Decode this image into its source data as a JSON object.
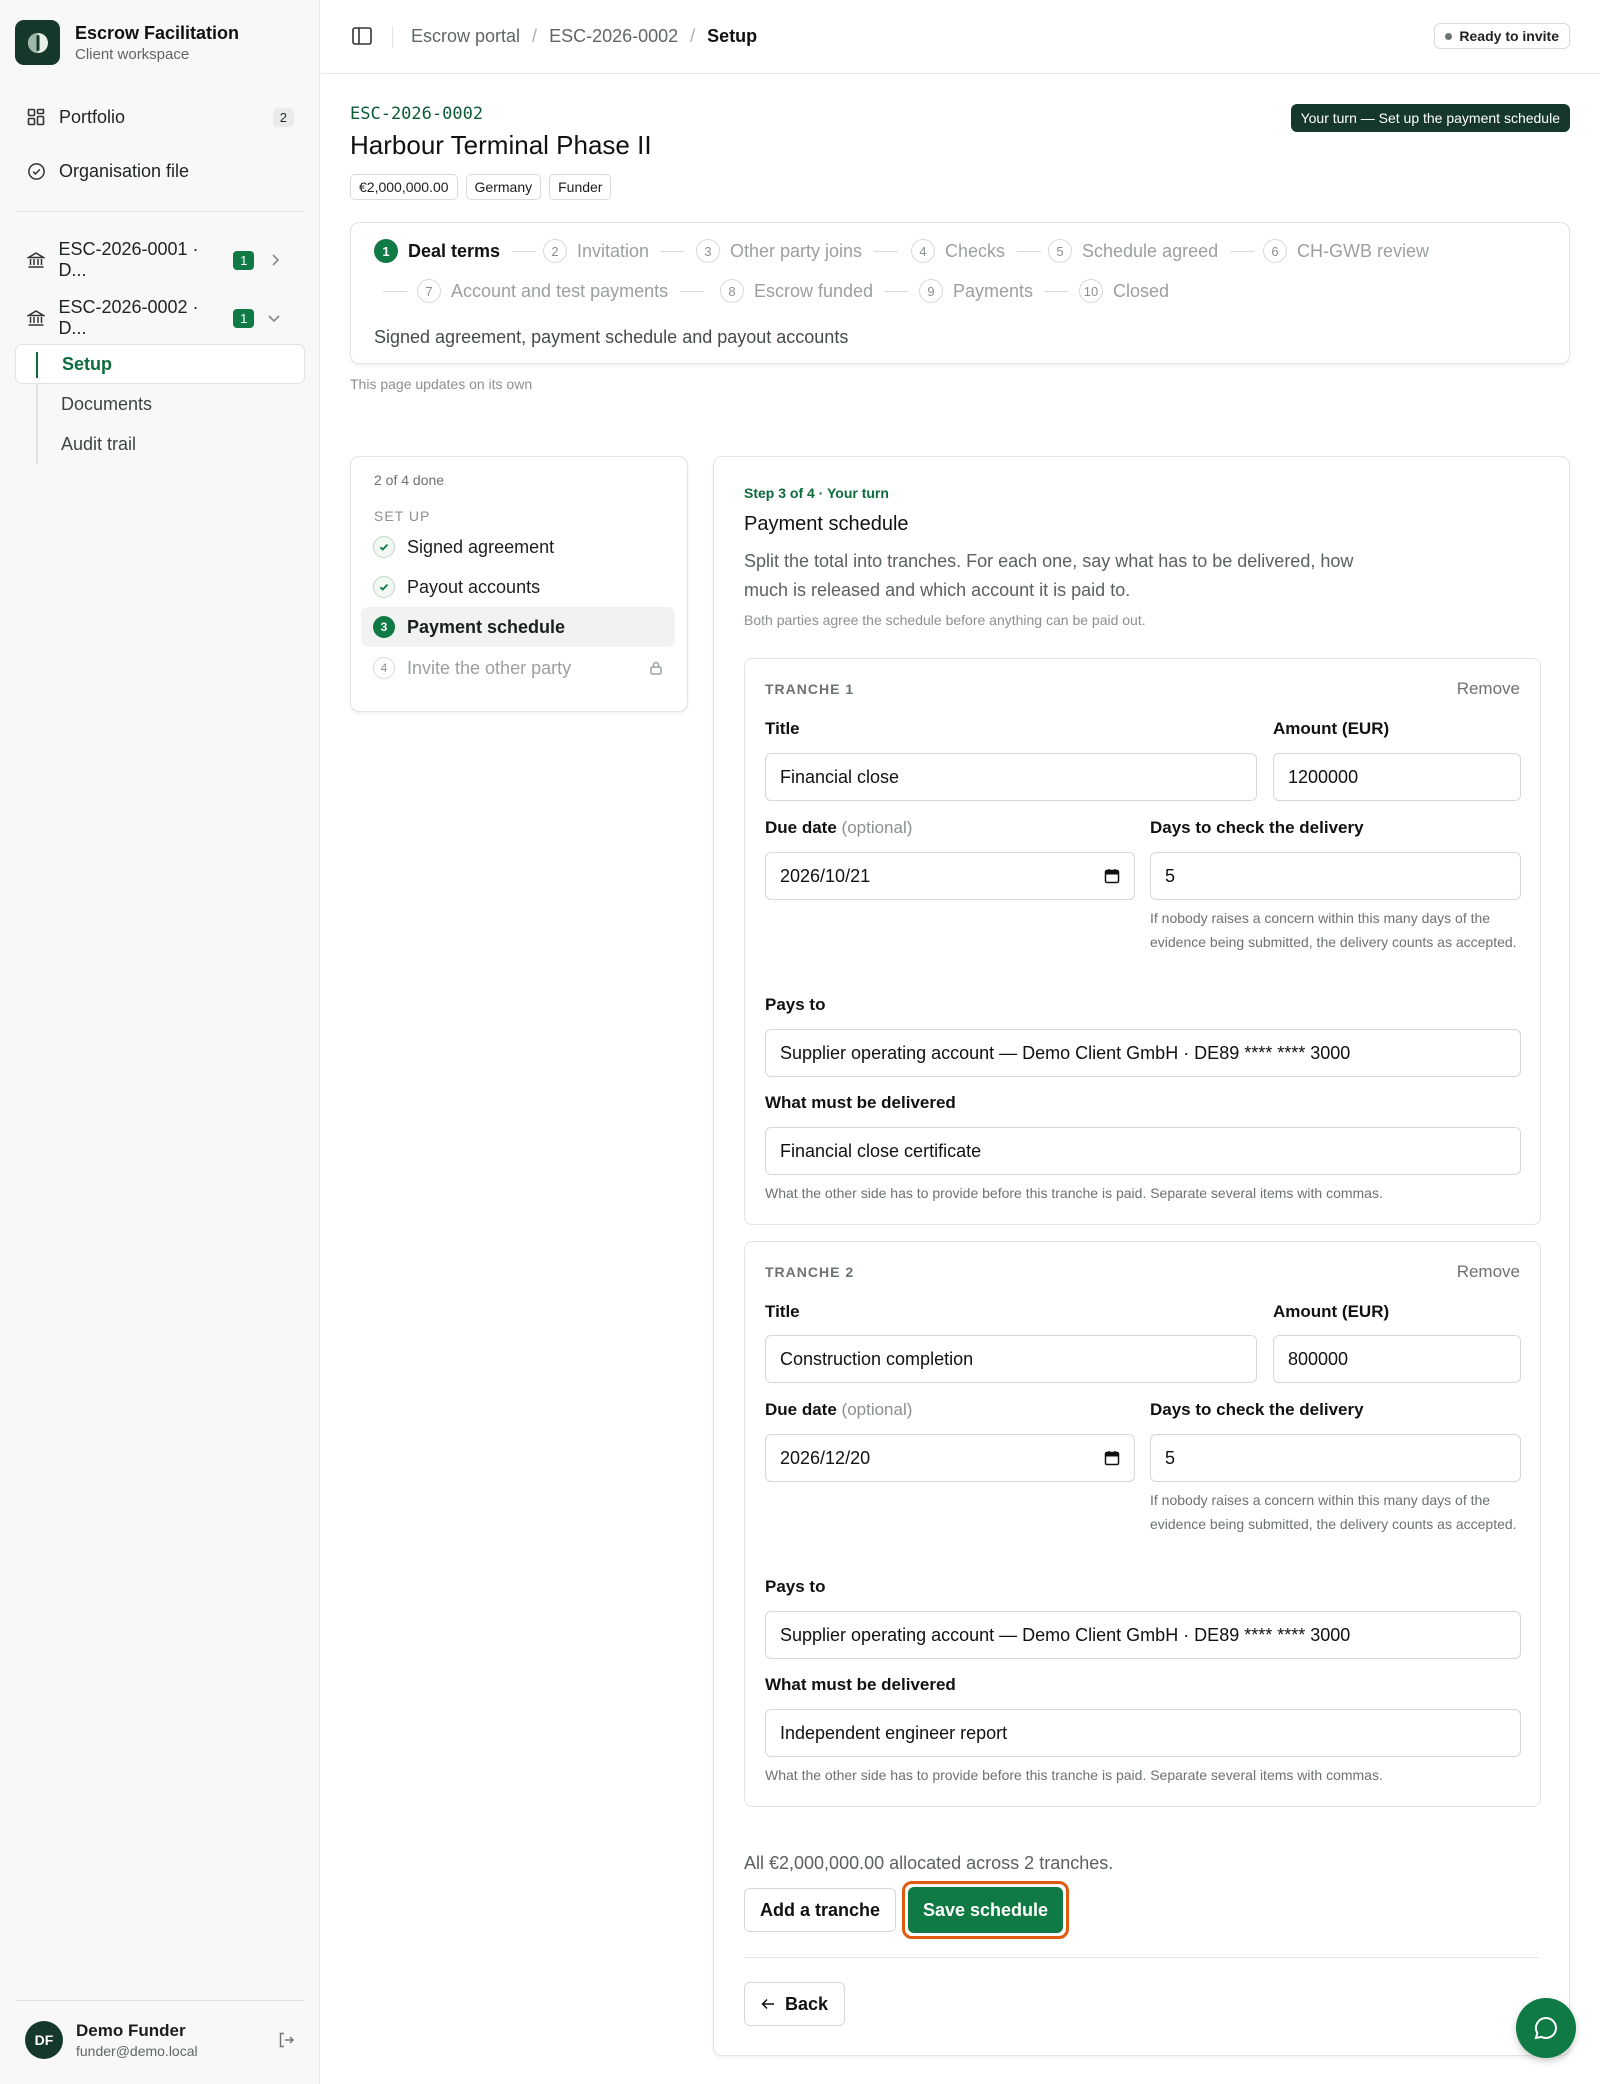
{
  "brand": {
    "name": "Escrow Facilitation",
    "subtitle": "Client workspace"
  },
  "sidebar": {
    "portfolio": {
      "label": "Portfolio",
      "count": "2"
    },
    "organisation": {
      "label": "Organisation file"
    },
    "escrows": [
      {
        "label": "ESC-2026-0001 · D...",
        "badge": "1",
        "icon": "bank-icon",
        "expanded": false
      },
      {
        "label": "ESC-2026-0002 · D...",
        "badge": "1",
        "icon": "bank-icon",
        "expanded": true
      }
    ],
    "subitems": [
      "Setup",
      "Documents",
      "Audit trail"
    ],
    "active_subitem": "Setup"
  },
  "user": {
    "initials": "DF",
    "name": "Demo Funder",
    "email": "funder@demo.local"
  },
  "header": {
    "crumbs": [
      "Escrow portal",
      "ESC-2026-0002",
      "Setup"
    ],
    "status": "Ready to invite"
  },
  "escrow": {
    "code": "ESC-2026-0002",
    "title": "Harbour Terminal Phase II",
    "chips": [
      "€2,000,000.00",
      "Germany",
      "Funder"
    ],
    "turn_banner": "Your turn — Set up the payment schedule"
  },
  "progress": {
    "steps": [
      {
        "n": "1",
        "label": "Deal terms"
      },
      {
        "n": "2",
        "label": "Invitation"
      },
      {
        "n": "3",
        "label": "Other party joins"
      },
      {
        "n": "4",
        "label": "Checks"
      },
      {
        "n": "5",
        "label": "Schedule agreed"
      },
      {
        "n": "6",
        "label": "CH-GWB review"
      },
      {
        "n": "7",
        "label": "Account and test payments"
      },
      {
        "n": "8",
        "label": "Escrow funded"
      },
      {
        "n": "9",
        "label": "Payments"
      },
      {
        "n": "10",
        "label": "Closed"
      }
    ],
    "current_step": 1,
    "description": "Signed agreement, payment schedule and payout accounts",
    "updates_note": "This page updates on its own"
  },
  "checklist": {
    "done": "2 of 4 done",
    "heading": "SET UP",
    "items": [
      {
        "n": "1",
        "label": "Signed agreement",
        "state": "done"
      },
      {
        "n": "2",
        "label": "Payout accounts",
        "state": "done"
      },
      {
        "n": "3",
        "label": "Payment schedule",
        "state": "current"
      },
      {
        "n": "4",
        "label": "Invite the other party",
        "state": "locked"
      }
    ]
  },
  "form": {
    "step_label": "Step 3 of 4 · Your turn",
    "title": "Payment schedule",
    "description": "Split the total into tranches. For each one, say what has to be delivered, how much is released and which account it is paid to.",
    "note": "Both parties agree the schedule before anything can be paid out.",
    "labels": {
      "remove": "Remove",
      "title": "Title",
      "amount": "Amount (EUR)",
      "due_date": "Due date",
      "optional": "(optional)",
      "days": "Days to check the delivery",
      "days_help": "If nobody raises a concern within this many days of the evidence being submitted, the delivery counts as accepted.",
      "pays_to": "Pays to",
      "deliverable": "What must be delivered",
      "deliverable_help": "What the other side has to provide before this tranche is paid. Separate several items with commas."
    },
    "tranches": [
      {
        "heading": "TRANCHE 1",
        "title": "Financial close",
        "amount": "1200000",
        "due_date": "2026/10/21",
        "days": "5",
        "pays_to": "Supplier operating account — Demo Client GmbH · DE89 **** **** 3000",
        "deliverable": "Financial close certificate"
      },
      {
        "heading": "TRANCHE 2",
        "title": "Construction completion",
        "amount": "800000",
        "due_date": "2026/12/20",
        "days": "5",
        "pays_to": "Supplier operating account — Demo Client GmbH · DE89 **** **** 3000",
        "deliverable": "Independent engineer report"
      }
    ],
    "allocation": "All €2,000,000.00 allocated across 2 tranches.",
    "add_button": "Add a tranche",
    "save_button": "Save schedule",
    "back_button": "Back"
  }
}
